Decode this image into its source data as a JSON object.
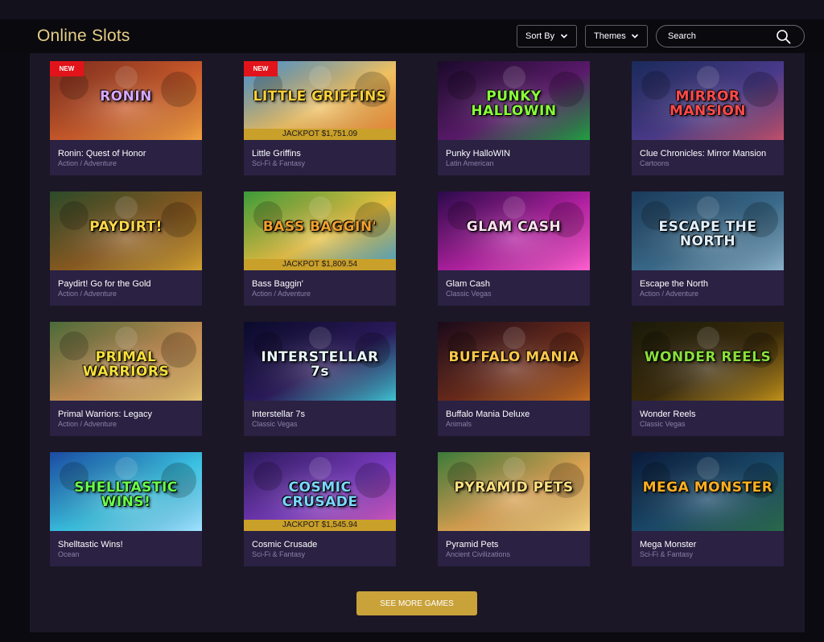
{
  "header": {
    "title": "Online Slots",
    "sort_label": "Sort By",
    "themes_label": "Themes",
    "search_placeholder": "Search"
  },
  "colors": {
    "accent_gold": "#e6cf86",
    "jackpot_bar": "#c9a029",
    "new_badge": "#e2131a",
    "card_bg": "#2a2143",
    "panel_bg": "#1b1726"
  },
  "games": [
    {
      "title": "Ronin: Quest of Honor",
      "genre": "Action / Adventure",
      "logo": "RONIN",
      "badge": "NEW",
      "jackpot": ""
    },
    {
      "title": "Little Griffins",
      "genre": "Sci-Fi & Fantasy",
      "logo": "LITTLE GRIFFINS",
      "badge": "NEW",
      "jackpot": "JACKPOT $1,751.09"
    },
    {
      "title": "Punky HalloWIN",
      "genre": "Latin American",
      "logo": "PUNKY HALLOWIN",
      "badge": "",
      "jackpot": ""
    },
    {
      "title": "Clue Chronicles: Mirror Mansion",
      "genre": "Cartoons",
      "logo": "MIRROR MANSION",
      "badge": "",
      "jackpot": ""
    },
    {
      "title": "Paydirt! Go for the Gold",
      "genre": "Action / Adventure",
      "logo": "PAYDIRT!",
      "badge": "",
      "jackpot": ""
    },
    {
      "title": "Bass Baggin'",
      "genre": "Action / Adventure",
      "logo": "BASS BAGGIN'",
      "badge": "",
      "jackpot": "JACKPOT $1,809.54"
    },
    {
      "title": "Glam Cash",
      "genre": "Classic Vegas",
      "logo": "GLAM CASH",
      "badge": "",
      "jackpot": ""
    },
    {
      "title": "Escape the North",
      "genre": "Action / Adventure",
      "logo": "ESCAPE THE NORTH",
      "badge": "",
      "jackpot": ""
    },
    {
      "title": "Primal Warriors: Legacy",
      "genre": "Action / Adventure",
      "logo": "PRIMAL WARRIORS",
      "badge": "",
      "jackpot": ""
    },
    {
      "title": "Interstellar 7s",
      "genre": "Classic Vegas",
      "logo": "INTERSTELLAR 7s",
      "badge": "",
      "jackpot": ""
    },
    {
      "title": "Buffalo Mania Deluxe",
      "genre": "Animals",
      "logo": "BUFFALO MANIA",
      "badge": "",
      "jackpot": ""
    },
    {
      "title": "Wonder Reels",
      "genre": "Classic Vegas",
      "logo": "WONDER REELS",
      "badge": "",
      "jackpot": ""
    },
    {
      "title": "Shelltastic Wins!",
      "genre": "Ocean",
      "logo": "SHELLTASTIC WINS!",
      "badge": "",
      "jackpot": ""
    },
    {
      "title": "Cosmic Crusade",
      "genre": "Sci-Fi & Fantasy",
      "logo": "COSMIC CRUSADE",
      "badge": "",
      "jackpot": "JACKPOT $1,545.94"
    },
    {
      "title": "Pyramid Pets",
      "genre": "Ancient Civilizations",
      "logo": "PYRAMID PETS",
      "badge": "",
      "jackpot": ""
    },
    {
      "title": "Mega Monster",
      "genre": "Sci-Fi & Fantasy",
      "logo": "MEGA MONSTER",
      "badge": "",
      "jackpot": ""
    }
  ],
  "footer": {
    "see_more_label": "SEE MORE GAMES"
  }
}
